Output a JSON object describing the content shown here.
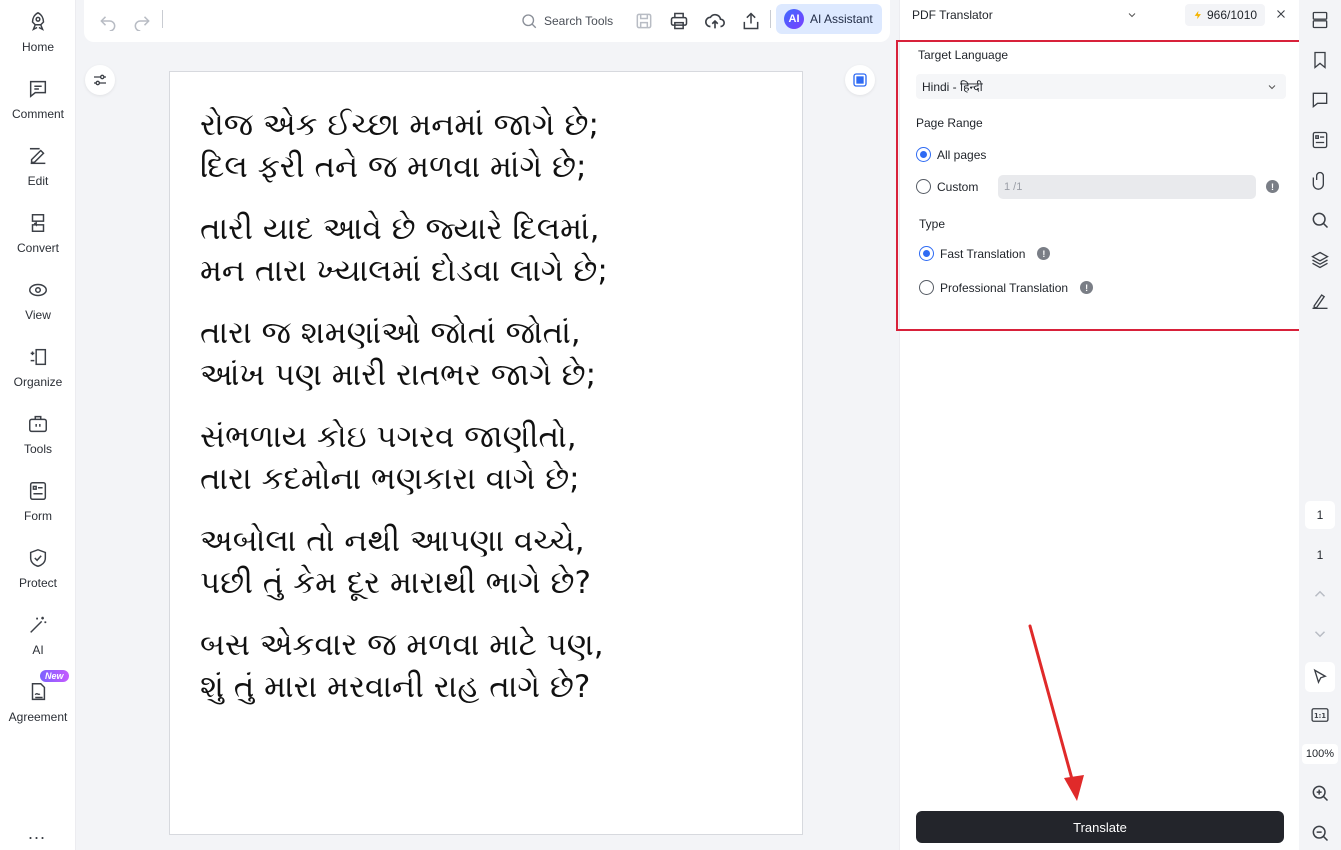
{
  "nav": {
    "items": [
      {
        "label": "Home",
        "icon": "rocket-icon"
      },
      {
        "label": "Comment",
        "icon": "comment-icon"
      },
      {
        "label": "Edit",
        "icon": "edit-icon"
      },
      {
        "label": "Convert",
        "icon": "convert-icon"
      },
      {
        "label": "View",
        "icon": "eye-icon"
      },
      {
        "label": "Organize",
        "icon": "organize-icon"
      },
      {
        "label": "Tools",
        "icon": "toolbox-icon"
      },
      {
        "label": "Form",
        "icon": "form-icon"
      },
      {
        "label": "Protect",
        "icon": "shield-icon"
      },
      {
        "label": "AI",
        "icon": "magic-wand-icon"
      },
      {
        "label": "Agreement",
        "icon": "agreement-icon",
        "badge": "New"
      }
    ],
    "more": "..."
  },
  "toolbar": {
    "search_label": "Search Tools",
    "ai_logo": "AI",
    "ai_label": "AI Assistant"
  },
  "document": {
    "stanzas": [
      [
        "રોજ એક ઈચ્છા મનમાં જાગે છે;",
        "દિલ ફરી તને જ મળવા માંગે છે;"
      ],
      [
        "તારી યાદ આવે છે જ્યારે દિલમાં,",
        "મન તારા ખ્યાલમાં દોડવા લાગે છે;"
      ],
      [
        "તારા જ શમણાંઓ જોતાં જોતાં,",
        "આંખ પણ મારી રાતભર જાગે છે;"
      ],
      [
        "સંભળાય કોઇ પગરવ જાણીતો,",
        "તારા કદમોના ભણકારા વાગે છે;"
      ],
      [
        "અબોલા તો નથી આપણા વચ્ચે,",
        "પછી તું કેમ દૂર મારાથી ભાગે છે?"
      ],
      [
        "બસ એકવાર જ મળવા માટે પણ,",
        "શું તું મારા મરવાની રાહ તાગે છે?"
      ]
    ]
  },
  "panel": {
    "tool_name": "PDF Translator",
    "credits": "966/1010",
    "target_language_label": "Target Language",
    "target_language_value": "Hindi - हिन्दी",
    "page_range_label": "Page Range",
    "all_pages_label": "All pages",
    "custom_label": "Custom",
    "custom_range_value": "1 /1",
    "type_label": "Type",
    "fast_label": "Fast Translation",
    "professional_label": "Professional Translation",
    "translate_label": "Translate",
    "info_glyph": "!",
    "selected_page_range": "All pages",
    "selected_type": "Fast Translation",
    "highlight_color": "#d8213a"
  },
  "rail": {
    "current_page": "1",
    "total_pages": "1",
    "fit_label": "1:1",
    "zoom": "100%"
  },
  "colors": {
    "accent": "#2f6bf3",
    "translate_button": "#23252b",
    "annotation_arrow": "#e02a2a"
  }
}
